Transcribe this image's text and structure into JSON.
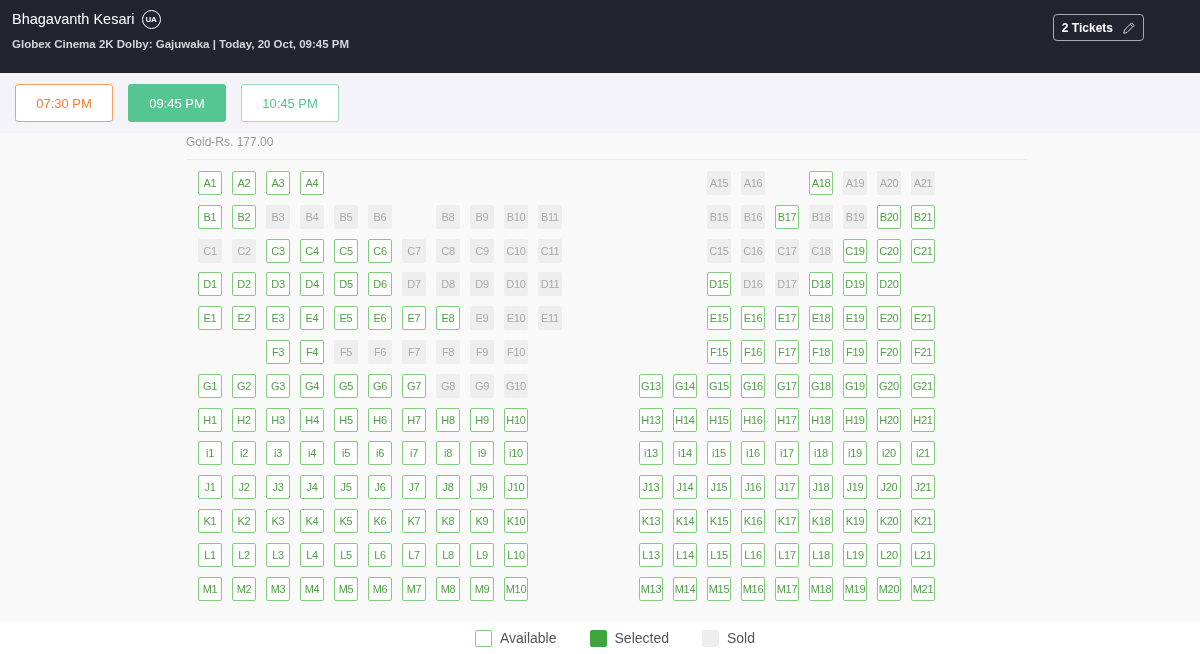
{
  "header": {
    "title": "Bhagavanth Kesari",
    "certificate": "UA",
    "details": "Globex Cinema 2K Dolby: Gajuwaka | Today, 20 Oct, 09:45 PM",
    "tickets_button": "2 Tickets"
  },
  "showtimes": [
    {
      "time": "07:30 PM",
      "filling_fast": true,
      "selected": false
    },
    {
      "time": "09:45 PM",
      "filling_fast": false,
      "selected": true
    },
    {
      "time": "10:45 PM",
      "filling_fast": false,
      "selected": false
    }
  ],
  "seat_map": {
    "price_label": "Gold-Rs. 177.00",
    "rows": [
      {
        "left": [
          {
            "kind": "seat",
            "label": "A1",
            "sold": false
          },
          {
            "kind": "seat",
            "label": "A2",
            "sold": false
          },
          {
            "kind": "seat",
            "label": "A3",
            "sold": false
          },
          {
            "kind": "seat",
            "label": "A4",
            "sold": false
          }
        ],
        "right": [
          {
            "kind": "space"
          },
          {
            "kind": "space"
          },
          {
            "kind": "seat",
            "label": "A15",
            "sold": true
          },
          {
            "kind": "seat",
            "label": "A16",
            "sold": true
          },
          {
            "kind": "space"
          },
          {
            "kind": "seat",
            "label": "A18",
            "sold": false
          },
          {
            "kind": "seat",
            "label": "A19",
            "sold": true
          },
          {
            "kind": "seat",
            "label": "A20",
            "sold": true
          },
          {
            "kind": "seat",
            "label": "A21",
            "sold": true
          }
        ]
      },
      {
        "left": [
          {
            "kind": "seat",
            "label": "B1",
            "sold": false
          },
          {
            "kind": "seat",
            "label": "B2",
            "sold": false
          },
          {
            "kind": "seat",
            "label": "B3",
            "sold": true
          },
          {
            "kind": "seat",
            "label": "B4",
            "sold": true
          },
          {
            "kind": "seat",
            "label": "B5",
            "sold": true
          },
          {
            "kind": "seat",
            "label": "B6",
            "sold": true
          },
          {
            "kind": "space"
          },
          {
            "kind": "seat",
            "label": "B8",
            "sold": true
          },
          {
            "kind": "seat",
            "label": "B9",
            "sold": true
          },
          {
            "kind": "seat",
            "label": "B10",
            "sold": true
          },
          {
            "kind": "seat",
            "label": "B11",
            "sold": true
          }
        ],
        "right": [
          {
            "kind": "space"
          },
          {
            "kind": "space"
          },
          {
            "kind": "seat",
            "label": "B15",
            "sold": true
          },
          {
            "kind": "seat",
            "label": "B16",
            "sold": true
          },
          {
            "kind": "seat",
            "label": "B17",
            "sold": false
          },
          {
            "kind": "seat",
            "label": "B18",
            "sold": true
          },
          {
            "kind": "seat",
            "label": "B19",
            "sold": true
          },
          {
            "kind": "seat",
            "label": "B20",
            "sold": false
          },
          {
            "kind": "seat",
            "label": "B21",
            "sold": false
          }
        ]
      },
      {
        "left": [
          {
            "kind": "seat",
            "label": "C1",
            "sold": true
          },
          {
            "kind": "seat",
            "label": "C2",
            "sold": true
          },
          {
            "kind": "seat",
            "label": "C3",
            "sold": false
          },
          {
            "kind": "seat",
            "label": "C4",
            "sold": false
          },
          {
            "kind": "seat",
            "label": "C5",
            "sold": false
          },
          {
            "kind": "seat",
            "label": "C6",
            "sold": false
          },
          {
            "kind": "seat",
            "label": "C7",
            "sold": true
          },
          {
            "kind": "seat",
            "label": "C8",
            "sold": true
          },
          {
            "kind": "seat",
            "label": "C9",
            "sold": true
          },
          {
            "kind": "seat",
            "label": "C10",
            "sold": true
          },
          {
            "kind": "seat",
            "label": "C11",
            "sold": true
          }
        ],
        "right": [
          {
            "kind": "space"
          },
          {
            "kind": "space"
          },
          {
            "kind": "seat",
            "label": "C15",
            "sold": true
          },
          {
            "kind": "seat",
            "label": "C16",
            "sold": true
          },
          {
            "kind": "seat",
            "label": "C17",
            "sold": true
          },
          {
            "kind": "seat",
            "label": "C18",
            "sold": true
          },
          {
            "kind": "seat",
            "label": "C19",
            "sold": false
          },
          {
            "kind": "seat",
            "label": "C20",
            "sold": false
          },
          {
            "kind": "seat",
            "label": "C21",
            "sold": false
          }
        ]
      },
      {
        "left": [
          {
            "kind": "seat",
            "label": "D1",
            "sold": false
          },
          {
            "kind": "seat",
            "label": "D2",
            "sold": false
          },
          {
            "kind": "seat",
            "label": "D3",
            "sold": false
          },
          {
            "kind": "seat",
            "label": "D4",
            "sold": false
          },
          {
            "kind": "seat",
            "label": "D5",
            "sold": false
          },
          {
            "kind": "seat",
            "label": "D6",
            "sold": false
          },
          {
            "kind": "seat",
            "label": "D7",
            "sold": true
          },
          {
            "kind": "seat",
            "label": "D8",
            "sold": true
          },
          {
            "kind": "seat",
            "label": "D9",
            "sold": true
          },
          {
            "kind": "seat",
            "label": "D10",
            "sold": true
          },
          {
            "kind": "seat",
            "label": "D11",
            "sold": true
          }
        ],
        "right": [
          {
            "kind": "space"
          },
          {
            "kind": "space"
          },
          {
            "kind": "seat",
            "label": "D15",
            "sold": false
          },
          {
            "kind": "seat",
            "label": "D16",
            "sold": true
          },
          {
            "kind": "seat",
            "label": "D17",
            "sold": true
          },
          {
            "kind": "seat",
            "label": "D18",
            "sold": false
          },
          {
            "kind": "seat",
            "label": "D19",
            "sold": false
          },
          {
            "kind": "seat",
            "label": "D20",
            "sold": false
          }
        ]
      },
      {
        "left": [
          {
            "kind": "seat",
            "label": "E1",
            "sold": false
          },
          {
            "kind": "seat",
            "label": "E2",
            "sold": false
          },
          {
            "kind": "seat",
            "label": "E3",
            "sold": false
          },
          {
            "kind": "seat",
            "label": "E4",
            "sold": false
          },
          {
            "kind": "seat",
            "label": "E5",
            "sold": false
          },
          {
            "kind": "seat",
            "label": "E6",
            "sold": false
          },
          {
            "kind": "seat",
            "label": "E7",
            "sold": false
          },
          {
            "kind": "seat",
            "label": "E8",
            "sold": false
          },
          {
            "kind": "seat",
            "label": "E9",
            "sold": true
          },
          {
            "kind": "seat",
            "label": "E10",
            "sold": true
          },
          {
            "kind": "seat",
            "label": "E11",
            "sold": true
          }
        ],
        "right": [
          {
            "kind": "space"
          },
          {
            "kind": "space"
          },
          {
            "kind": "seat",
            "label": "E15",
            "sold": false
          },
          {
            "kind": "seat",
            "label": "E16",
            "sold": false
          },
          {
            "kind": "seat",
            "label": "E17",
            "sold": false
          },
          {
            "kind": "seat",
            "label": "E18",
            "sold": false
          },
          {
            "kind": "seat",
            "label": "E19",
            "sold": false
          },
          {
            "kind": "seat",
            "label": "E20",
            "sold": false
          },
          {
            "kind": "seat",
            "label": "E21",
            "sold": false
          }
        ]
      },
      {
        "left": [
          {
            "kind": "space"
          },
          {
            "kind": "space"
          },
          {
            "kind": "seat",
            "label": "F3",
            "sold": false
          },
          {
            "kind": "seat",
            "label": "F4",
            "sold": false
          },
          {
            "kind": "seat",
            "label": "F5",
            "sold": true
          },
          {
            "kind": "seat",
            "label": "F6",
            "sold": true
          },
          {
            "kind": "seat",
            "label": "F7",
            "sold": true
          },
          {
            "kind": "seat",
            "label": "F8",
            "sold": true
          },
          {
            "kind": "seat",
            "label": "F9",
            "sold": true
          },
          {
            "kind": "seat",
            "label": "F10",
            "sold": true
          }
        ],
        "right": [
          {
            "kind": "space"
          },
          {
            "kind": "space"
          },
          {
            "kind": "seat",
            "label": "F15",
            "sold": false
          },
          {
            "kind": "seat",
            "label": "F16",
            "sold": false
          },
          {
            "kind": "seat",
            "label": "F17",
            "sold": false
          },
          {
            "kind": "seat",
            "label": "F18",
            "sold": false
          },
          {
            "kind": "seat",
            "label": "F19",
            "sold": false
          },
          {
            "kind": "seat",
            "label": "F20",
            "sold": false
          },
          {
            "kind": "seat",
            "label": "F21",
            "sold": false
          }
        ]
      },
      {
        "left": [
          {
            "kind": "seat",
            "label": "G1",
            "sold": false
          },
          {
            "kind": "seat",
            "label": "G2",
            "sold": false
          },
          {
            "kind": "seat",
            "label": "G3",
            "sold": false
          },
          {
            "kind": "seat",
            "label": "G4",
            "sold": false
          },
          {
            "kind": "seat",
            "label": "G5",
            "sold": false
          },
          {
            "kind": "seat",
            "label": "G6",
            "sold": false
          },
          {
            "kind": "seat",
            "label": "G7",
            "sold": false
          },
          {
            "kind": "seat",
            "label": "G8",
            "sold": true
          },
          {
            "kind": "seat",
            "label": "G9",
            "sold": true
          },
          {
            "kind": "seat",
            "label": "G10",
            "sold": true
          }
        ],
        "right": [
          {
            "kind": "seat",
            "label": "G13",
            "sold": false
          },
          {
            "kind": "seat",
            "label": "G14",
            "sold": false
          },
          {
            "kind": "seat",
            "label": "G15",
            "sold": false
          },
          {
            "kind": "seat",
            "label": "G16",
            "sold": false
          },
          {
            "kind": "seat",
            "label": "G17",
            "sold": false
          },
          {
            "kind": "seat",
            "label": "G18",
            "sold": false
          },
          {
            "kind": "seat",
            "label": "G19",
            "sold": false
          },
          {
            "kind": "seat",
            "label": "G20",
            "sold": false
          },
          {
            "kind": "seat",
            "label": "G21",
            "sold": false
          }
        ]
      },
      {
        "left": [
          {
            "kind": "seat",
            "label": "H1",
            "sold": false
          },
          {
            "kind": "seat",
            "label": "H2",
            "sold": false
          },
          {
            "kind": "seat",
            "label": "H3",
            "sold": false
          },
          {
            "kind": "seat",
            "label": "H4",
            "sold": false
          },
          {
            "kind": "seat",
            "label": "H5",
            "sold": false
          },
          {
            "kind": "seat",
            "label": "H6",
            "sold": false
          },
          {
            "kind": "seat",
            "label": "H7",
            "sold": false
          },
          {
            "kind": "seat",
            "label": "H8",
            "sold": false
          },
          {
            "kind": "seat",
            "label": "H9",
            "sold": false
          },
          {
            "kind": "seat",
            "label": "H10",
            "sold": false
          }
        ],
        "right": [
          {
            "kind": "seat",
            "label": "H13",
            "sold": false
          },
          {
            "kind": "seat",
            "label": "H14",
            "sold": false
          },
          {
            "kind": "seat",
            "label": "H15",
            "sold": false
          },
          {
            "kind": "seat",
            "label": "H16",
            "sold": false
          },
          {
            "kind": "seat",
            "label": "H17",
            "sold": false
          },
          {
            "kind": "seat",
            "label": "H18",
            "sold": false
          },
          {
            "kind": "seat",
            "label": "H19",
            "sold": false
          },
          {
            "kind": "seat",
            "label": "H20",
            "sold": false
          },
          {
            "kind": "seat",
            "label": "H21",
            "sold": false
          }
        ]
      },
      {
        "left": [
          {
            "kind": "seat",
            "label": "i1",
            "sold": false
          },
          {
            "kind": "seat",
            "label": "i2",
            "sold": false
          },
          {
            "kind": "seat",
            "label": "i3",
            "sold": false
          },
          {
            "kind": "seat",
            "label": "i4",
            "sold": false
          },
          {
            "kind": "seat",
            "label": "i5",
            "sold": false
          },
          {
            "kind": "seat",
            "label": "i6",
            "sold": false
          },
          {
            "kind": "seat",
            "label": "i7",
            "sold": false
          },
          {
            "kind": "seat",
            "label": "i8",
            "sold": false
          },
          {
            "kind": "seat",
            "label": "i9",
            "sold": false
          },
          {
            "kind": "seat",
            "label": "i10",
            "sold": false
          }
        ],
        "right": [
          {
            "kind": "seat",
            "label": "i13",
            "sold": false
          },
          {
            "kind": "seat",
            "label": "i14",
            "sold": false
          },
          {
            "kind": "seat",
            "label": "i15",
            "sold": false
          },
          {
            "kind": "seat",
            "label": "i16",
            "sold": false
          },
          {
            "kind": "seat",
            "label": "i17",
            "sold": false
          },
          {
            "kind": "seat",
            "label": "i18",
            "sold": false
          },
          {
            "kind": "seat",
            "label": "i19",
            "sold": false
          },
          {
            "kind": "seat",
            "label": "i20",
            "sold": false
          },
          {
            "kind": "seat",
            "label": "i21",
            "sold": false
          }
        ]
      },
      {
        "left": [
          {
            "kind": "seat",
            "label": "J1",
            "sold": false
          },
          {
            "kind": "seat",
            "label": "J2",
            "sold": false
          },
          {
            "kind": "seat",
            "label": "J3",
            "sold": false
          },
          {
            "kind": "seat",
            "label": "J4",
            "sold": false
          },
          {
            "kind": "seat",
            "label": "J5",
            "sold": false
          },
          {
            "kind": "seat",
            "label": "J6",
            "sold": false
          },
          {
            "kind": "seat",
            "label": "J7",
            "sold": false
          },
          {
            "kind": "seat",
            "label": "J8",
            "sold": false
          },
          {
            "kind": "seat",
            "label": "J9",
            "sold": false
          },
          {
            "kind": "seat",
            "label": "J10",
            "sold": false
          }
        ],
        "right": [
          {
            "kind": "seat",
            "label": "J13",
            "sold": false
          },
          {
            "kind": "seat",
            "label": "J14",
            "sold": false
          },
          {
            "kind": "seat",
            "label": "J15",
            "sold": false
          },
          {
            "kind": "seat",
            "label": "J16",
            "sold": false
          },
          {
            "kind": "seat",
            "label": "J17",
            "sold": false
          },
          {
            "kind": "seat",
            "label": "J18",
            "sold": false
          },
          {
            "kind": "seat",
            "label": "J19",
            "sold": false
          },
          {
            "kind": "seat",
            "label": "J20",
            "sold": false
          },
          {
            "kind": "seat",
            "label": "J21",
            "sold": false
          }
        ]
      },
      {
        "left": [
          {
            "kind": "seat",
            "label": "K1",
            "sold": false
          },
          {
            "kind": "seat",
            "label": "K2",
            "sold": false
          },
          {
            "kind": "seat",
            "label": "K3",
            "sold": false
          },
          {
            "kind": "seat",
            "label": "K4",
            "sold": false
          },
          {
            "kind": "seat",
            "label": "K5",
            "sold": false
          },
          {
            "kind": "seat",
            "label": "K6",
            "sold": false
          },
          {
            "kind": "seat",
            "label": "K7",
            "sold": false
          },
          {
            "kind": "seat",
            "label": "K8",
            "sold": false
          },
          {
            "kind": "seat",
            "label": "K9",
            "sold": false
          },
          {
            "kind": "seat",
            "label": "K10",
            "sold": false
          }
        ],
        "right": [
          {
            "kind": "seat",
            "label": "K13",
            "sold": false
          },
          {
            "kind": "seat",
            "label": "K14",
            "sold": false
          },
          {
            "kind": "seat",
            "label": "K15",
            "sold": false
          },
          {
            "kind": "seat",
            "label": "K16",
            "sold": false
          },
          {
            "kind": "seat",
            "label": "K17",
            "sold": false
          },
          {
            "kind": "seat",
            "label": "K18",
            "sold": false
          },
          {
            "kind": "seat",
            "label": "K19",
            "sold": false
          },
          {
            "kind": "seat",
            "label": "K20",
            "sold": false
          },
          {
            "kind": "seat",
            "label": "K21",
            "sold": false
          }
        ]
      },
      {
        "left": [
          {
            "kind": "seat",
            "label": "L1",
            "sold": false
          },
          {
            "kind": "seat",
            "label": "L2",
            "sold": false
          },
          {
            "kind": "seat",
            "label": "L3",
            "sold": false
          },
          {
            "kind": "seat",
            "label": "L4",
            "sold": false
          },
          {
            "kind": "seat",
            "label": "L5",
            "sold": false
          },
          {
            "kind": "seat",
            "label": "L6",
            "sold": false
          },
          {
            "kind": "seat",
            "label": "L7",
            "sold": false
          },
          {
            "kind": "seat",
            "label": "L8",
            "sold": false
          },
          {
            "kind": "seat",
            "label": "L9",
            "sold": false
          },
          {
            "kind": "seat",
            "label": "L10",
            "sold": false
          }
        ],
        "right": [
          {
            "kind": "seat",
            "label": "L13",
            "sold": false
          },
          {
            "kind": "seat",
            "label": "L14",
            "sold": false
          },
          {
            "kind": "seat",
            "label": "L15",
            "sold": false
          },
          {
            "kind": "seat",
            "label": "L16",
            "sold": false
          },
          {
            "kind": "seat",
            "label": "L17",
            "sold": false
          },
          {
            "kind": "seat",
            "label": "L18",
            "sold": false
          },
          {
            "kind": "seat",
            "label": "L19",
            "sold": false
          },
          {
            "kind": "seat",
            "label": "L20",
            "sold": false
          },
          {
            "kind": "seat",
            "label": "L21",
            "sold": false
          }
        ]
      },
      {
        "left": [
          {
            "kind": "seat",
            "label": "M1",
            "sold": false
          },
          {
            "kind": "seat",
            "label": "M2",
            "sold": false
          },
          {
            "kind": "seat",
            "label": "M3",
            "sold": false
          },
          {
            "kind": "seat",
            "label": "M4",
            "sold": false
          },
          {
            "kind": "seat",
            "label": "M5",
            "sold": false
          },
          {
            "kind": "seat",
            "label": "M6",
            "sold": false
          },
          {
            "kind": "seat",
            "label": "M7",
            "sold": false
          },
          {
            "kind": "seat",
            "label": "M8",
            "sold": false
          },
          {
            "kind": "seat",
            "label": "M9",
            "sold": false
          },
          {
            "kind": "seat",
            "label": "M10",
            "sold": false
          }
        ],
        "right": [
          {
            "kind": "seat",
            "label": "M13",
            "sold": false
          },
          {
            "kind": "seat",
            "label": "M14",
            "sold": false
          },
          {
            "kind": "seat",
            "label": "M15",
            "sold": false
          },
          {
            "kind": "seat",
            "label": "M16",
            "sold": false
          },
          {
            "kind": "seat",
            "label": "M17",
            "sold": false
          },
          {
            "kind": "seat",
            "label": "M18",
            "sold": false
          },
          {
            "kind": "seat",
            "label": "M19",
            "sold": false
          },
          {
            "kind": "seat",
            "label": "M20",
            "sold": false
          },
          {
            "kind": "seat",
            "label": "M21",
            "sold": false
          }
        ]
      }
    ]
  },
  "legend": [
    {
      "label": "Available",
      "kind": "available"
    },
    {
      "label": "Selected",
      "kind": "selected"
    },
    {
      "label": "Sold",
      "kind": "sold"
    }
  ]
}
